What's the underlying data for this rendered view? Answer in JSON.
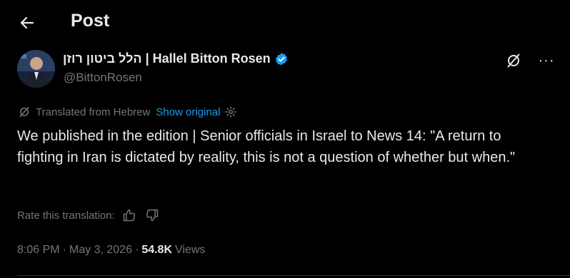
{
  "header": {
    "title": "Post",
    "back_icon": "arrow-left-icon"
  },
  "author": {
    "display_name": "הלל ביטון רוזן | Hallel Bitton Rosen",
    "handle": "@BittonRosen",
    "verified": true,
    "verified_color": "#1d9bf0",
    "actions": [
      "grok-translate-icon",
      "more-icon"
    ],
    "more_label": "···"
  },
  "translation": {
    "notice": "Translated from Hebrew",
    "show_original": "Show original",
    "rate_label": "Rate this translation:"
  },
  "post": {
    "text": "We published in the edition | Senior officials in Israel to News 14: \"A return to fighting in Iran is dictated by reality, this is not a question of whether but when.\""
  },
  "meta": {
    "time": "8:06 PM",
    "date": "May 3, 2026",
    "separator": "·",
    "views_count": "54.8K",
    "views_label": "Views"
  },
  "colors": {
    "background": "#000000",
    "text": "#e7e9ea",
    "secondary": "#71767b",
    "accent": "#1d9bf0"
  }
}
